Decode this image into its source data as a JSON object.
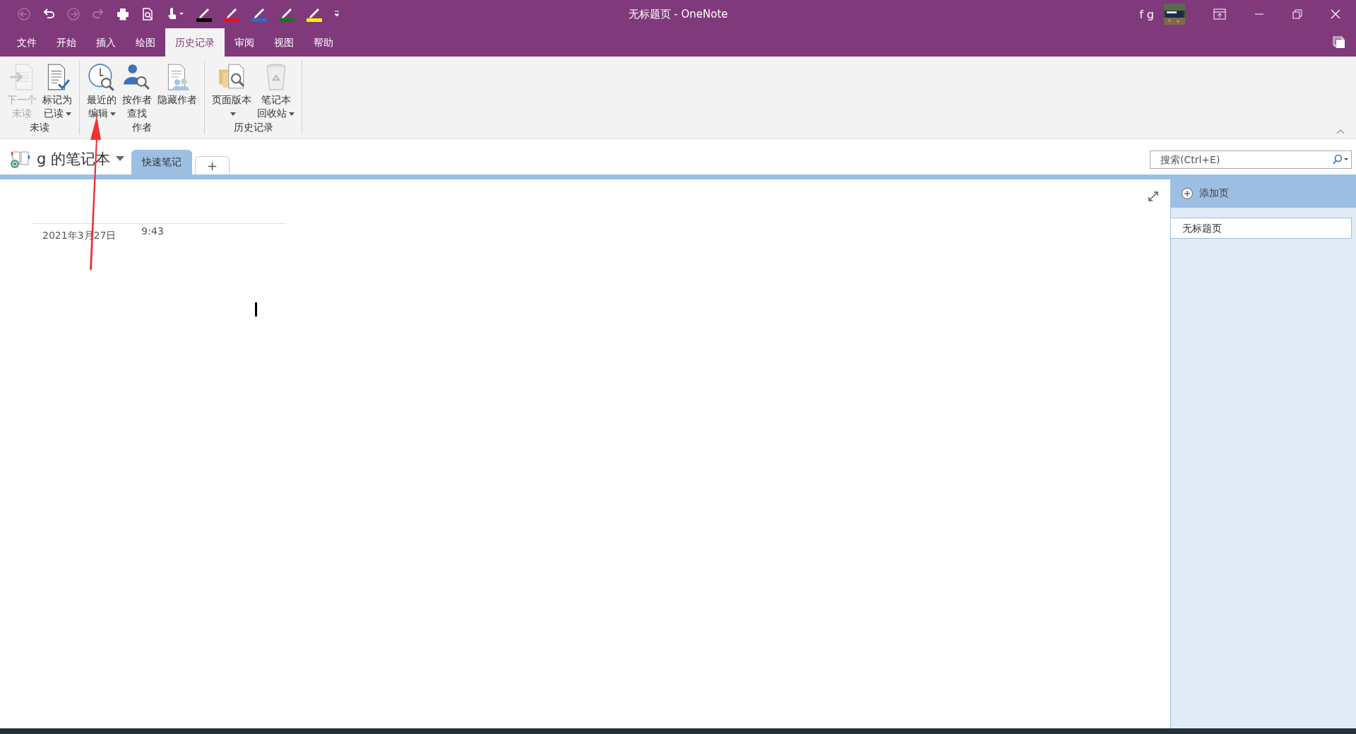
{
  "window": {
    "title": "无标题页 - OneNote",
    "user": "f g"
  },
  "quick_access": [
    {
      "kind": "back",
      "disabled": true
    },
    {
      "kind": "undo",
      "disabled": false
    },
    {
      "kind": "forward",
      "disabled": true
    },
    {
      "kind": "redo",
      "disabled": true
    },
    {
      "kind": "print",
      "disabled": false
    },
    {
      "kind": "preview",
      "disabled": false
    },
    {
      "kind": "touch",
      "disabled": false
    }
  ],
  "pens": [
    {
      "color": "#000000"
    },
    {
      "color": "#e81123"
    },
    {
      "color": "#2b6cc4"
    },
    {
      "color": "#107c10"
    },
    {
      "color": "#fff100"
    }
  ],
  "tabs": [
    {
      "label": "文件",
      "selected": false
    },
    {
      "label": "开始",
      "selected": false
    },
    {
      "label": "插入",
      "selected": false
    },
    {
      "label": "绘图",
      "selected": false
    },
    {
      "label": "历史记录",
      "selected": true
    },
    {
      "label": "审阅",
      "selected": false
    },
    {
      "label": "视图",
      "selected": false
    },
    {
      "label": "帮助",
      "selected": false
    }
  ],
  "ribbon_groups": [
    {
      "label": "未读",
      "buttons": [
        {
          "kind": "next-unread",
          "lines": [
            "下一个",
            "未读"
          ],
          "disabled": true,
          "dropdown": false
        },
        {
          "kind": "mark-read",
          "lines": [
            "标记为",
            "已读"
          ],
          "disabled": false,
          "dropdown": true
        }
      ]
    },
    {
      "label": "作者",
      "buttons": [
        {
          "kind": "recent",
          "lines": [
            "最近的",
            "编辑"
          ],
          "disabled": false,
          "dropdown": true
        },
        {
          "kind": "find-author",
          "lines": [
            "按作者",
            "查找"
          ],
          "disabled": false,
          "dropdown": false
        },
        {
          "kind": "hide-authors",
          "lines": [
            "隐藏作者"
          ],
          "disabled": false,
          "dropdown": false
        }
      ]
    },
    {
      "label": "历史记录",
      "buttons": [
        {
          "kind": "versions",
          "lines": [
            "页面版本"
          ],
          "disabled": false,
          "dropdown": true
        },
        {
          "kind": "recycle",
          "lines": [
            "笔记本",
            "回收站"
          ],
          "disabled": false,
          "dropdown": true
        }
      ]
    }
  ],
  "notebook": {
    "name": "g 的笔记本"
  },
  "sections": [
    {
      "label": "快速笔记",
      "selected": true
    }
  ],
  "new_section": "+",
  "search": {
    "placeholder": "搜索(Ctrl+E)"
  },
  "page": {
    "date": "2021年3月27日",
    "time": "9:43"
  },
  "page_list": {
    "add_page": "添加页",
    "pages": [
      {
        "title": "无标题页",
        "selected": true
      }
    ]
  }
}
